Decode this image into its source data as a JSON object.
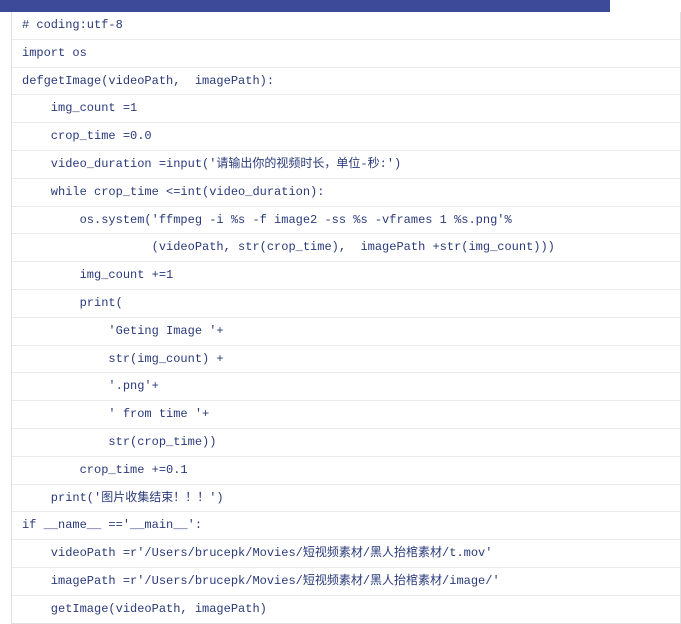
{
  "code_lines": [
    {
      "indent": 0,
      "text": "# coding:utf-8"
    },
    {
      "indent": 0,
      "text": "import os"
    },
    {
      "indent": 0,
      "text": "defgetImage(videoPath,  imagePath):"
    },
    {
      "indent": 1,
      "text": "img_count =1"
    },
    {
      "indent": 1,
      "text": "crop_time =0.0"
    },
    {
      "indent": 1,
      "text": "video_duration =input('请输出你的视频时长，单位-秒:')"
    },
    {
      "indent": 1,
      "text": "while crop_time <=int(video_duration):"
    },
    {
      "indent": 2,
      "text": "os.system('ffmpeg -i %s -f image2 -ss %s -vframes 1 %s.png'%"
    },
    {
      "indent": 2,
      "text": "          (videoPath, str(crop_time),  imagePath +str(img_count)))"
    },
    {
      "indent": 2,
      "text": "img_count +=1"
    },
    {
      "indent": 2,
      "text": "print("
    },
    {
      "indent": 3,
      "text": "'Geting Image '+"
    },
    {
      "indent": 3,
      "text": "str(img_count) +"
    },
    {
      "indent": 3,
      "text": "'.png'+"
    },
    {
      "indent": 3,
      "text": "' from time '+"
    },
    {
      "indent": 3,
      "text": "str(crop_time))"
    },
    {
      "indent": 2,
      "text": "crop_time +=0.1"
    },
    {
      "indent": 1,
      "text": "print('图片收集结束！！！')"
    },
    {
      "indent": 0,
      "text": "if __name__ =='__main__':"
    },
    {
      "indent": 1,
      "text": "videoPath =r'/Users/brucepk/Movies/短视频素材/黑人抬棺素材/t.mov'"
    },
    {
      "indent": 1,
      "text": "imagePath =r'/Users/brucepk/Movies/短视频素材/黑人抬棺素材/image/'"
    },
    {
      "indent": 1,
      "text": "getImage(videoPath, imagePath)"
    }
  ]
}
